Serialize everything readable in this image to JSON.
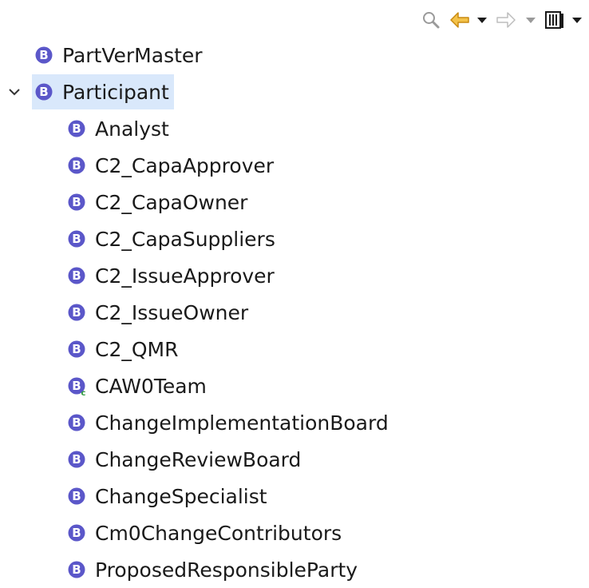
{
  "toolbar": {
    "icons": [
      "search-icon",
      "back-arrow-icon",
      "dropdown-icon",
      "forward-arrow-icon",
      "dropdown-icon",
      "book-icon",
      "dropdown-icon"
    ],
    "colors": {
      "back_arrow": "#e6a21a",
      "forward_arrow": "#c8c8c8",
      "dark": "#1a1a1a",
      "search": "#9a9a9a"
    }
  },
  "tree": {
    "root_items": [
      {
        "label": "PartVerMaster",
        "icon": "business-object-icon",
        "expanded": false
      },
      {
        "label": "Participant",
        "icon": "business-object-icon",
        "expanded": true,
        "selected": true
      }
    ],
    "children": [
      {
        "label": "Analyst",
        "icon": "business-object-icon"
      },
      {
        "label": "C2_CapaApprover",
        "icon": "business-object-icon"
      },
      {
        "label": "C2_CapaOwner",
        "icon": "business-object-icon"
      },
      {
        "label": "C2_CapaSuppliers",
        "icon": "business-object-icon"
      },
      {
        "label": "C2_IssueApprover",
        "icon": "business-object-icon"
      },
      {
        "label": "C2_IssueOwner",
        "icon": "business-object-icon"
      },
      {
        "label": "C2_QMR",
        "icon": "business-object-icon"
      },
      {
        "label": "CAW0Team",
        "icon": "business-object-custom-icon"
      },
      {
        "label": "ChangeImplementationBoard",
        "icon": "business-object-icon"
      },
      {
        "label": "ChangeReviewBoard",
        "icon": "business-object-icon"
      },
      {
        "label": "ChangeSpecialist",
        "icon": "business-object-icon"
      },
      {
        "label": "Cm0ChangeContributors",
        "icon": "business-object-icon"
      },
      {
        "label": "ProposedResponsibleParty",
        "icon": "business-object-icon"
      }
    ],
    "colors": {
      "icon_fill": "#5b57c9",
      "icon_text": "#ffffff",
      "selection": "#d9e8fb",
      "custom_marker": "#2e9a3e"
    }
  }
}
